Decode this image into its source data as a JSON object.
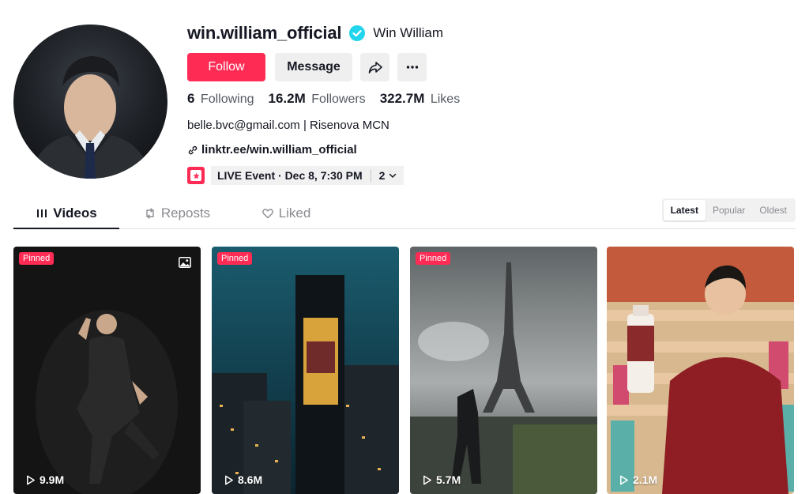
{
  "profile": {
    "username": "win.william_official",
    "display_name": "Win William",
    "verified_icon": "verified-badge-icon",
    "bio": "belle.bvc@gmail.com | Risenova MCN",
    "link": "linktr.ee/win.william_official",
    "colors": {
      "accent": "#fe2c55",
      "verified": "#20d5ec"
    }
  },
  "actions": {
    "follow_label": "Follow",
    "message_label": "Message",
    "share_icon": "share-icon",
    "more_icon": "more-icon"
  },
  "stats": [
    {
      "value": "6",
      "label": "Following"
    },
    {
      "value": "16.2M",
      "label": "Followers"
    },
    {
      "value": "322.7M",
      "label": "Likes"
    }
  ],
  "event": {
    "text": "LIVE Event · Dec 8, 7:30 PM",
    "count": "2"
  },
  "tabs": [
    {
      "label": "Videos",
      "icon": "grid-icon",
      "active": true
    },
    {
      "label": "Reposts",
      "icon": "repost-icon",
      "active": false
    },
    {
      "label": "Liked",
      "icon": "heart-icon",
      "active": false
    }
  ],
  "sort": [
    {
      "label": "Latest",
      "active": true
    },
    {
      "label": "Popular",
      "active": false
    },
    {
      "label": "Oldest",
      "active": false
    }
  ],
  "videos": [
    {
      "pinned": "Pinned",
      "views": "9.9M",
      "photo": true
    },
    {
      "pinned": "Pinned",
      "views": "8.6M",
      "photo": false
    },
    {
      "pinned": "Pinned",
      "views": "5.7M",
      "photo": false
    },
    {
      "pinned": "",
      "views": "2.1M",
      "photo": false
    }
  ]
}
